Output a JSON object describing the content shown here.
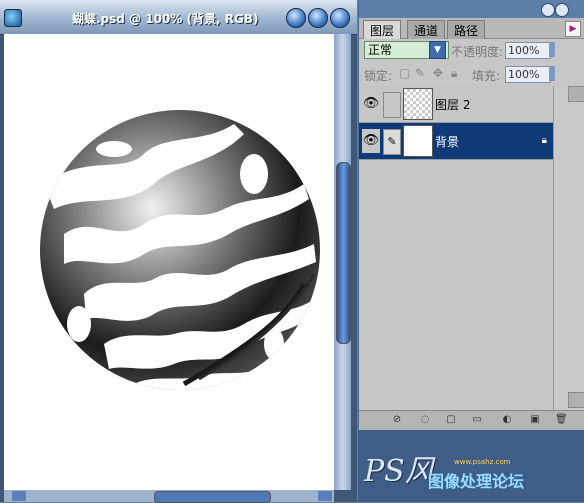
{
  "document": {
    "title": "蝴蝶.psd @ 100% (背景, RGB)",
    "window_buttons": [
      "minimize-icon",
      "maximize-icon",
      "close-icon"
    ]
  },
  "layers_panel": {
    "tabs": [
      "图层",
      "通道",
      "路径"
    ],
    "active_tab": "图层",
    "blend_mode": "正常",
    "opacity_label": "不透明度:",
    "opacity_value": "100%",
    "lock_label": "锁定:",
    "fill_label": "填充:",
    "fill_value": "100%",
    "layers": [
      {
        "name": "图层 2",
        "selected": false
      },
      {
        "name": "背景",
        "selected": true
      }
    ]
  },
  "brand": {
    "logo": "PS风",
    "url": "www.psahz.com",
    "subtitle": "图像处理论坛"
  },
  "colors": {
    "selected_row": "#0f3a78",
    "panel_bg": "#c7c7c7",
    "window_chrome": "#3f5876"
  }
}
